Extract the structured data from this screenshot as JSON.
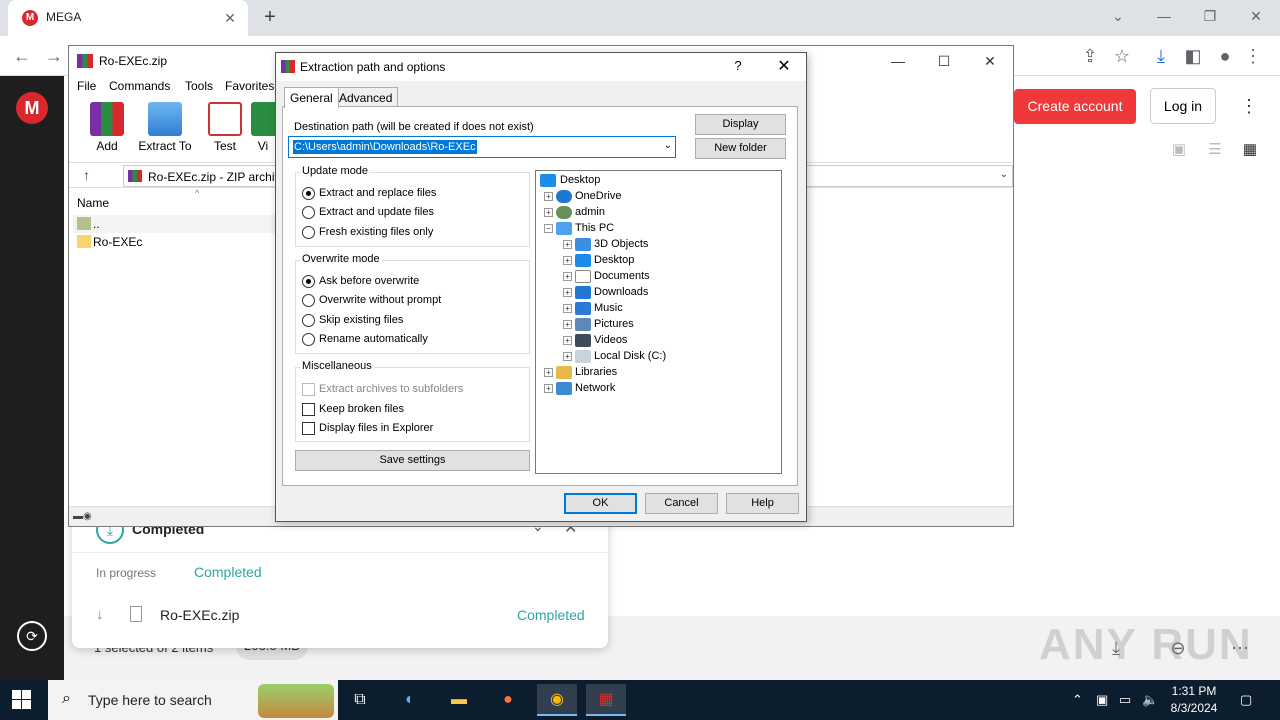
{
  "browser": {
    "tab_title": "MEGA",
    "tab_favicon": "M",
    "new_tab_icon": "+",
    "close_tab_icon": "✕"
  },
  "mega": {
    "logo": "M",
    "create_account": "Create account",
    "login": "Log in",
    "footer_selection": "1 selected of 2 items",
    "footer_size": "203.5 MB",
    "watermark": "ANY RUN"
  },
  "transfer": {
    "title": "Completed",
    "tab_in_progress": "In progress",
    "tab_completed": "Completed",
    "file_name": "Ro-EXEc.zip",
    "file_status": "Completed"
  },
  "winrar": {
    "title": "Ro-EXEc.zip",
    "menu": [
      "File",
      "Commands",
      "Tools",
      "Favorites"
    ],
    "tools": [
      "Add",
      "Extract To",
      "Test",
      "Vi"
    ],
    "path": "Ro-EXEc.zip - ZIP archive",
    "column_name": "Name",
    "rows": [
      "..",
      "Ro-EXEc"
    ]
  },
  "dialog": {
    "title": "Extraction path and options",
    "help_icon": "?",
    "tabs": [
      "General",
      "Advanced"
    ],
    "dest_label": "Destination path (will be created if does not exist)",
    "dest_value": "C:\\Users\\admin\\Downloads\\Ro-EXEc",
    "btn_display": "Display",
    "btn_new_folder": "New folder",
    "update_mode": {
      "title": "Update mode",
      "options": [
        "Extract and replace files",
        "Extract and update files",
        "Fresh existing files only"
      ],
      "selected": 0
    },
    "overwrite_mode": {
      "title": "Overwrite mode",
      "options": [
        "Ask before overwrite",
        "Overwrite without prompt",
        "Skip existing files",
        "Rename automatically"
      ],
      "selected": 0
    },
    "misc": {
      "title": "Miscellaneous",
      "options": [
        "Extract archives to subfolders",
        "Keep broken files",
        "Display files in Explorer"
      ]
    },
    "save_settings": "Save settings",
    "tree": [
      "Desktop",
      "OneDrive",
      "admin",
      "This PC",
      "3D Objects",
      "Desktop",
      "Documents",
      "Downloads",
      "Music",
      "Pictures",
      "Videos",
      "Local Disk (C:)",
      "Libraries",
      "Network"
    ],
    "btn_ok": "OK",
    "btn_cancel": "Cancel",
    "btn_help": "Help"
  },
  "taskbar": {
    "search_placeholder": "Type here to search",
    "time": "1:31 PM",
    "date": "8/3/2024"
  }
}
